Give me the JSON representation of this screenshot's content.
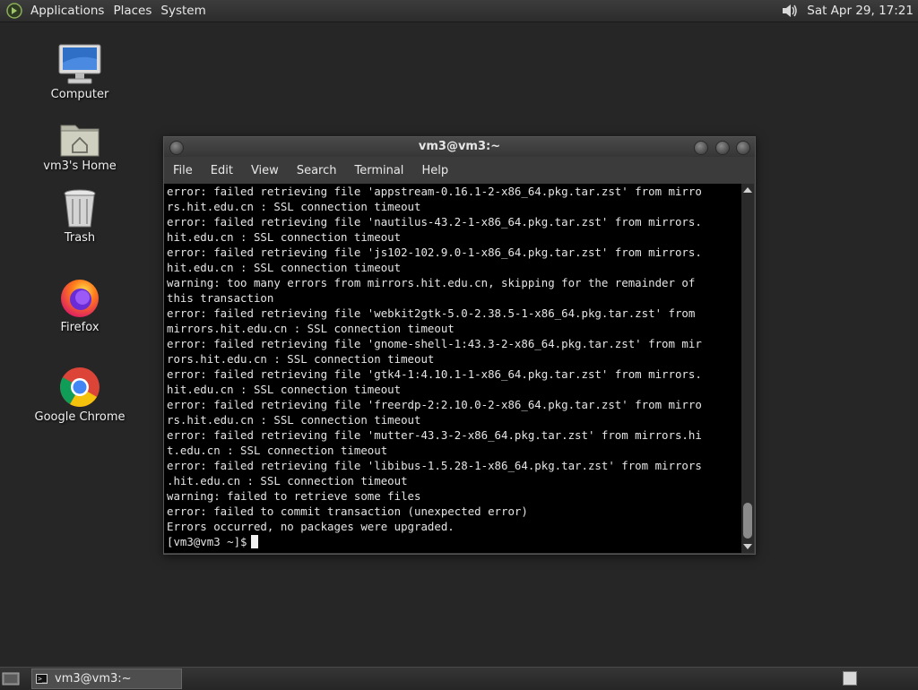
{
  "top_panel": {
    "menus": [
      "Applications",
      "Places",
      "System"
    ],
    "clock": "Sat Apr 29, 17:21"
  },
  "desktop": {
    "icons": [
      {
        "label": "Computer",
        "icon": "computer-icon"
      },
      {
        "label": "vm3's Home",
        "icon": "home-folder-icon"
      },
      {
        "label": "Trash",
        "icon": "trash-icon"
      },
      {
        "label": "Firefox",
        "icon": "firefox-icon"
      },
      {
        "label": "Google Chrome",
        "icon": "chrome-icon"
      }
    ]
  },
  "terminal": {
    "title": "vm3@vm3:~",
    "menus": [
      "File",
      "Edit",
      "View",
      "Search",
      "Terminal",
      "Help"
    ],
    "lines": [
      "error: failed retrieving file 'appstream-0.16.1-2-x86_64.pkg.tar.zst' from mirro",
      "rs.hit.edu.cn : SSL connection timeout",
      "error: failed retrieving file 'nautilus-43.2-1-x86_64.pkg.tar.zst' from mirrors.",
      "hit.edu.cn : SSL connection timeout",
      "error: failed retrieving file 'js102-102.9.0-1-x86_64.pkg.tar.zst' from mirrors.",
      "hit.edu.cn : SSL connection timeout",
      "warning: too many errors from mirrors.hit.edu.cn, skipping for the remainder of",
      "this transaction",
      "error: failed retrieving file 'webkit2gtk-5.0-2.38.5-1-x86_64.pkg.tar.zst' from",
      "mirrors.hit.edu.cn : SSL connection timeout",
      "error: failed retrieving file 'gnome-shell-1:43.3-2-x86_64.pkg.tar.zst' from mir",
      "rors.hit.edu.cn : SSL connection timeout",
      "error: failed retrieving file 'gtk4-1:4.10.1-1-x86_64.pkg.tar.zst' from mirrors.",
      "hit.edu.cn : SSL connection timeout",
      "error: failed retrieving file 'freerdp-2:2.10.0-2-x86_64.pkg.tar.zst' from mirro",
      "rs.hit.edu.cn : SSL connection timeout",
      "error: failed retrieving file 'mutter-43.3-2-x86_64.pkg.tar.zst' from mirrors.hi",
      "t.edu.cn : SSL connection timeout",
      "error: failed retrieving file 'libibus-1.5.28-1-x86_64.pkg.tar.zst' from mirrors",
      ".hit.edu.cn : SSL connection timeout",
      "warning: failed to retrieve some files",
      "error: failed to commit transaction (unexpected error)",
      "Errors occurred, no packages were upgraded."
    ],
    "prompt": "[vm3@vm3 ~]$"
  },
  "taskbar": {
    "task_label": "vm3@vm3:~"
  }
}
